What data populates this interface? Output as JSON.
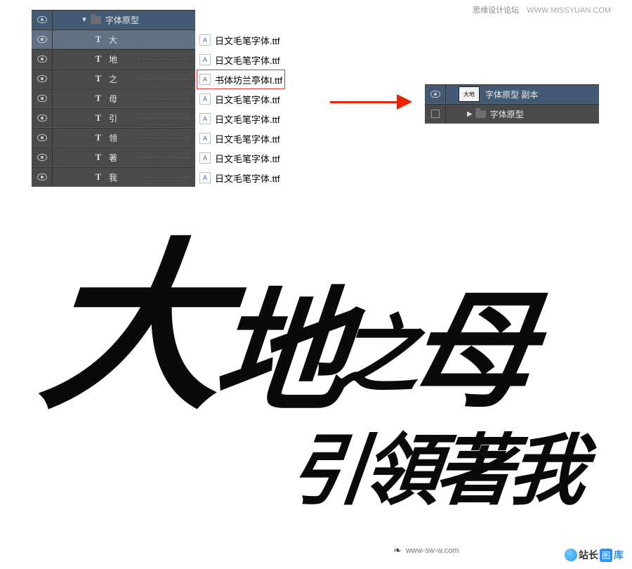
{
  "header": {
    "forum_name": "思缘设计论坛",
    "forum_url": "WWW.MISSYUAN.COM"
  },
  "left_panel": {
    "group_name": "字体原型",
    "layers": [
      {
        "char": "大",
        "selected": true
      },
      {
        "char": "地",
        "selected": false
      },
      {
        "char": "之",
        "selected": false
      },
      {
        "char": "母",
        "selected": false
      },
      {
        "char": "引",
        "selected": false
      },
      {
        "char": "领",
        "selected": false
      },
      {
        "char": "著",
        "selected": false
      },
      {
        "char": "我",
        "selected": false
      }
    ]
  },
  "font_files": [
    {
      "name": "日文毛笔字体.ttf",
      "highlight": false
    },
    {
      "name": "日文毛笔字体.ttf",
      "highlight": false
    },
    {
      "name": "书体坊兰亭体I.ttf",
      "highlight": true
    },
    {
      "name": "日文毛笔字体.ttf",
      "highlight": false
    },
    {
      "name": "日文毛笔字体.ttf",
      "highlight": false
    },
    {
      "name": "日文毛笔字体.ttf",
      "highlight": false
    },
    {
      "name": "日文毛笔字体.ttf",
      "highlight": false
    },
    {
      "name": "日文毛笔字体.ttf",
      "highlight": false
    }
  ],
  "right_panel": {
    "copy_name": "字体原型 副本",
    "group_name": "字体原型"
  },
  "artwork": {
    "line1_c1": "大",
    "line1_c2": "地",
    "line1_c3": "之",
    "line1_c4": "母",
    "line2": "引領著我"
  },
  "footer_left": {
    "url": "www-sw-w.com"
  },
  "footer_right": {
    "t1": "站长",
    "t2": "图",
    "t3": "库"
  }
}
